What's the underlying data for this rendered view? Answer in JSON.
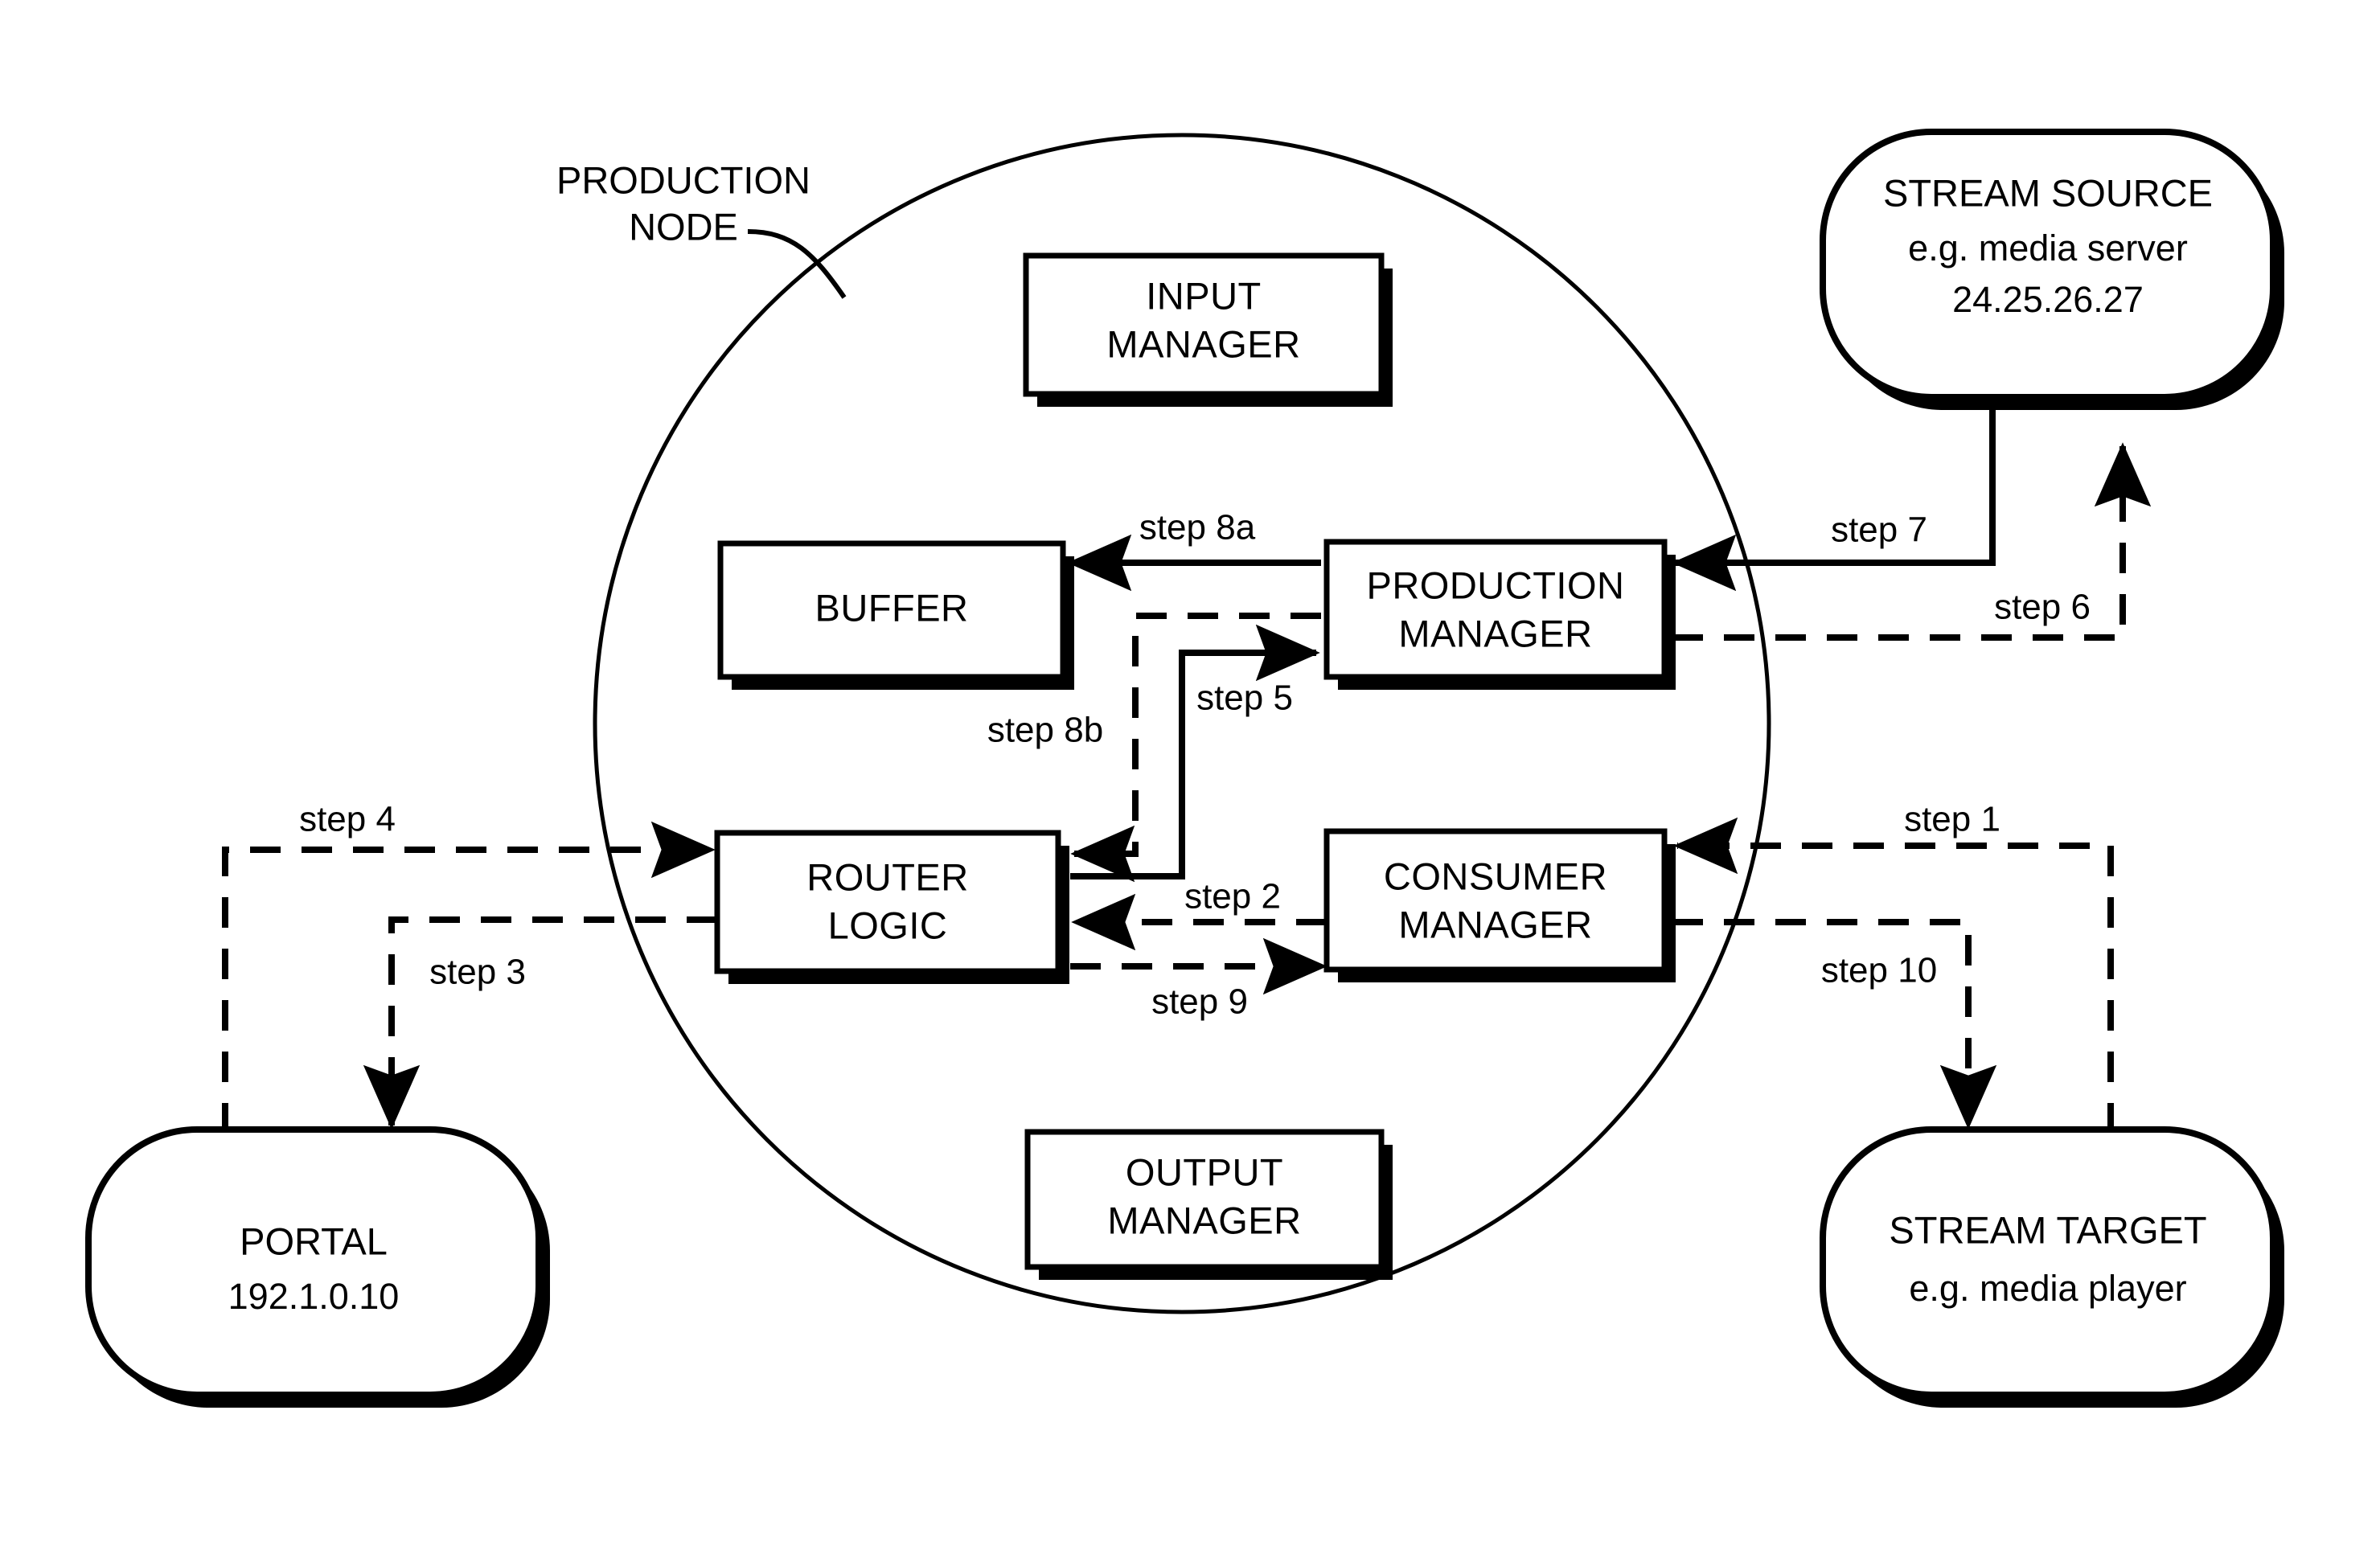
{
  "diagram": {
    "container_label": {
      "line1": "PRODUCTION",
      "line2": "NODE"
    },
    "internal_boxes": [
      {
        "id": "input-manager",
        "line1": "INPUT",
        "line2": "MANAGER"
      },
      {
        "id": "buffer",
        "line1": "BUFFER",
        "line2": ""
      },
      {
        "id": "production-manager",
        "line1": "PRODUCTION",
        "line2": "MANAGER"
      },
      {
        "id": "router-logic",
        "line1": "ROUTER",
        "line2": "LOGIC"
      },
      {
        "id": "consumer-manager",
        "line1": "CONSUMER",
        "line2": "MANAGER"
      },
      {
        "id": "output-manager",
        "line1": "OUTPUT",
        "line2": "MANAGER"
      }
    ],
    "external_nodes": [
      {
        "id": "stream-source",
        "line1": "STREAM SOURCE",
        "line2": "e.g. media server",
        "line3": "24.25.26.27"
      },
      {
        "id": "stream-target",
        "line1": "STREAM TARGET",
        "line2": "e.g. media player",
        "line3": ""
      },
      {
        "id": "portal",
        "line1": "PORTAL",
        "line2": "192.1.0.10",
        "line3": ""
      }
    ],
    "step_labels": [
      {
        "id": "step-1",
        "text": "step 1"
      },
      {
        "id": "step-2",
        "text": "step 2"
      },
      {
        "id": "step-3",
        "text": "step 3"
      },
      {
        "id": "step-4",
        "text": "step 4"
      },
      {
        "id": "step-5",
        "text": "step 5"
      },
      {
        "id": "step-6",
        "text": "step 6"
      },
      {
        "id": "step-7",
        "text": "step 7"
      },
      {
        "id": "step-8a",
        "text": "step 8a"
      },
      {
        "id": "step-8b",
        "text": "step 8b"
      },
      {
        "id": "step-9",
        "text": "step 9"
      },
      {
        "id": "step-10",
        "text": "step 10"
      }
    ],
    "colors": {
      "stroke": "#000000",
      "fill": "#ffffff"
    }
  }
}
